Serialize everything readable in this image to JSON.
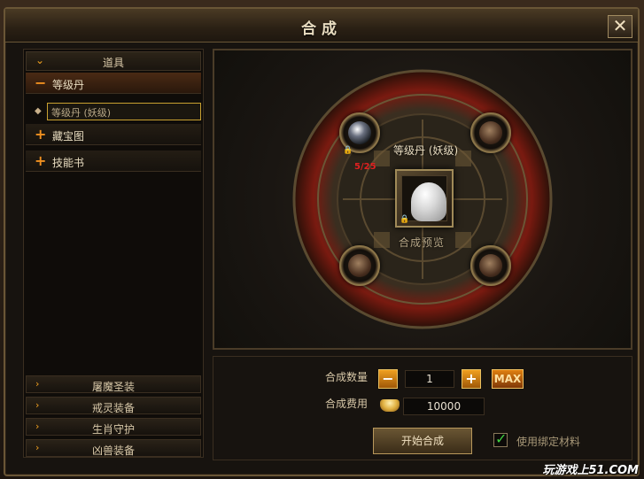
{
  "window": {
    "title": "合成",
    "close_glyph": "✕"
  },
  "sidebar": {
    "header": "道具",
    "tree": [
      {
        "toggle": "−",
        "label": "等级丹",
        "open": true
      },
      {
        "toggle": "+",
        "label": "藏宝图",
        "open": false
      },
      {
        "toggle": "+",
        "label": "技能书",
        "open": false
      }
    ],
    "sub_item": "等级丹 (妖级)",
    "bottom_categories": [
      "屠魔圣装",
      "戒灵装备",
      "生肖守护",
      "凶兽装备"
    ]
  },
  "stage": {
    "item_name": "等级丹 (妖级)",
    "preview_label": "合成预览",
    "material_count": "5/25",
    "slots": [
      {
        "name": "material-slot-top-left",
        "state": "filled"
      },
      {
        "name": "material-slot-top-right",
        "state": "empty"
      },
      {
        "name": "material-slot-bottom-left",
        "state": "empty"
      },
      {
        "name": "material-slot-bottom-right",
        "state": "empty"
      }
    ]
  },
  "controls": {
    "quantity_label": "合成数量",
    "quantity_value": "1",
    "minus": "−",
    "plus": "+",
    "max": "MAX",
    "cost_label": "合成费用",
    "cost_value": "10000",
    "start_button": "开始合成",
    "bound_checkbox_label": "使用绑定材料",
    "bound_checked": true
  },
  "watermark": "玩游戏上51.COM",
  "colors": {
    "accent": "#f0a020",
    "frame": "#6a5636",
    "red_count": "#e02020"
  }
}
